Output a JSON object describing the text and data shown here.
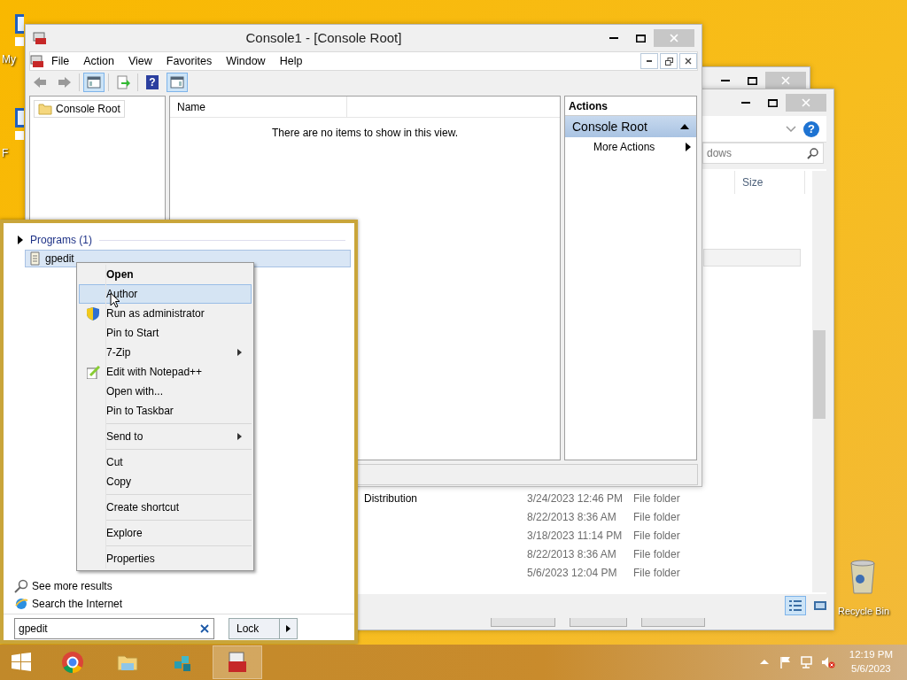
{
  "desktop_icons": [
    {
      "label": "My"
    },
    {
      "label": "F"
    }
  ],
  "explorer": {
    "help": "?",
    "search": {
      "placeholder": "dows"
    },
    "columns": [
      "Size"
    ],
    "rows": [
      {
        "name": "Distribution",
        "date": "3/24/2023 12:46 PM",
        "type": "File folder"
      },
      {
        "name": "",
        "date": "8/22/2013 8:36 AM",
        "type": "File folder"
      },
      {
        "name": "",
        "date": "3/18/2023 11:14 PM",
        "type": "File folder"
      },
      {
        "name": "",
        "date": "8/22/2013 8:36 AM",
        "type": "File folder"
      },
      {
        "name": "",
        "date": "5/6/2023 12:04 PM",
        "type": "File folder"
      }
    ],
    "views": [
      {
        "kind": "details",
        "selected": true
      },
      {
        "kind": "tiles",
        "selected": false
      }
    ]
  },
  "mmc": {
    "title": "Console1 - [Console Root]",
    "menu": [
      "File",
      "Action",
      "View",
      "Favorites",
      "Window",
      "Help"
    ],
    "toolbar": [
      {
        "kind": "back",
        "selected": false
      },
      {
        "kind": "forward",
        "selected": false
      },
      {
        "kind": "sep"
      },
      {
        "kind": "tree",
        "selected": true
      },
      {
        "kind": "sep"
      },
      {
        "kind": "export",
        "selected": false
      },
      {
        "kind": "sep"
      },
      {
        "kind": "help",
        "label": "?",
        "selected": false
      },
      {
        "kind": "actionpane",
        "selected": true
      }
    ],
    "tree": [
      {
        "label": "Console Root",
        "selected": true
      }
    ],
    "columns": [
      "Name"
    ],
    "empty_text": "There are no items to show in this view.",
    "actions": {
      "title": "Actions",
      "groups": [
        {
          "title": "Console Root",
          "expanded": true,
          "items": [
            {
              "label": "More Actions",
              "submenu": true
            }
          ]
        }
      ]
    }
  },
  "start_search": {
    "group": {
      "label": "Programs (1)",
      "expanded": false
    },
    "results": [
      {
        "label": "gpedit",
        "selected": true
      }
    ],
    "links": [
      {
        "kind": "search",
        "label": "See more results"
      },
      {
        "kind": "internet",
        "label": "Search the Internet"
      }
    ],
    "search_value": "gpedit",
    "power_button": "Lock"
  },
  "context_menu": [
    {
      "kind": "item",
      "label": "Open",
      "default": true,
      "selected": false
    },
    {
      "kind": "item",
      "label": "Author",
      "selected": true
    },
    {
      "kind": "admin",
      "label": "Run as administrator",
      "selected": false
    },
    {
      "kind": "item",
      "label": "Pin to Start",
      "selected": false
    },
    {
      "kind": "item",
      "label": "7-Zip",
      "submenu": true,
      "selected": false
    },
    {
      "kind": "editor",
      "label": "Edit with Notepad++",
      "selected": false
    },
    {
      "kind": "item",
      "label": "Open with...",
      "selected": false
    },
    {
      "kind": "item",
      "label": "Pin to Taskbar",
      "selected": false
    },
    {
      "kind": "separator"
    },
    {
      "kind": "item",
      "label": "Send to",
      "submenu": true,
      "selected": false
    },
    {
      "kind": "separator"
    },
    {
      "kind": "item",
      "label": "Cut",
      "selected": false
    },
    {
      "kind": "item",
      "label": "Copy",
      "selected": false
    },
    {
      "kind": "separator"
    },
    {
      "kind": "item",
      "label": "Create shortcut",
      "selected": false
    },
    {
      "kind": "separator"
    },
    {
      "kind": "item",
      "label": "Explore",
      "selected": false
    },
    {
      "kind": "separator"
    },
    {
      "kind": "item",
      "label": "Properties",
      "selected": false
    }
  ],
  "recycle_bin": {
    "label": "Recycle Bin"
  },
  "taskbar": {
    "apps": [
      {
        "kind": "start",
        "selected": false
      },
      {
        "kind": "browser",
        "selected": false
      },
      {
        "kind": "folder",
        "selected": false
      },
      {
        "kind": "cubes",
        "selected": false
      },
      {
        "kind": "toolbox",
        "selected": true
      }
    ],
    "tray": [
      {
        "kind": "chevron"
      },
      {
        "kind": "flag"
      },
      {
        "kind": "network"
      },
      {
        "kind": "muted"
      }
    ],
    "time": "12:19 PM",
    "date": "5/6/2023"
  }
}
